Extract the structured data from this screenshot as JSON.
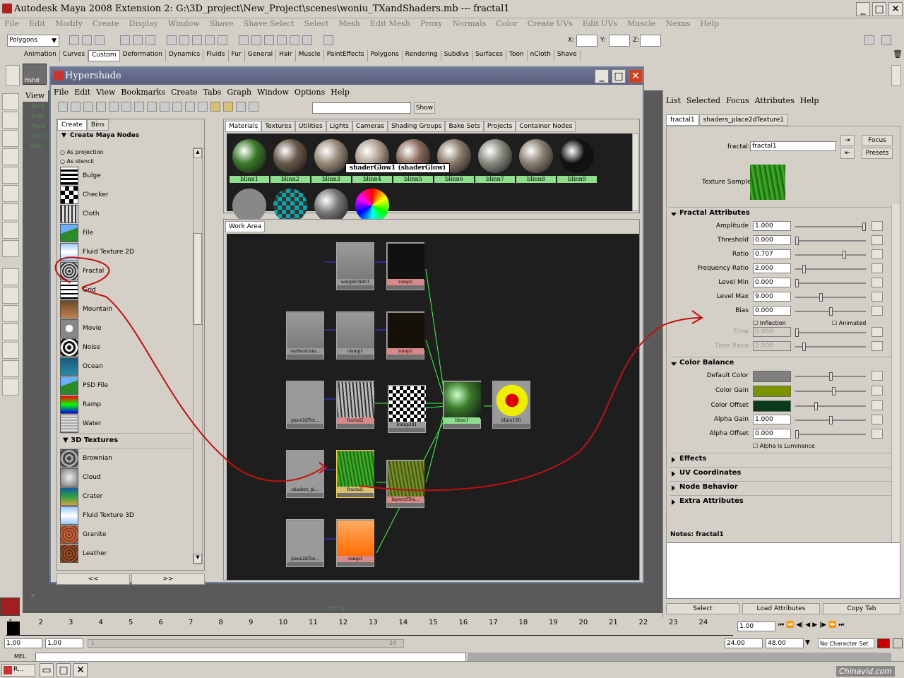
{
  "window": {
    "title": "Autodesk Maya 2008 Extension 2: G:\\3D_project\\New_Project\\scenes\\woniu_TXandShaders.mb   ---   fractal1"
  },
  "main_menu": [
    "File",
    "Edit",
    "Modify",
    "Create",
    "Display",
    "Window",
    "Shave",
    "Shave Select",
    "Select",
    "Mesh",
    "Edit Mesh",
    "Proxy",
    "Normals",
    "Color",
    "Create UVs",
    "Edit UVs",
    "Muscle",
    "Nexus",
    "Help"
  ],
  "status_line": {
    "mode_select": "Polygons",
    "x_label": "X:",
    "y_label": "Y:",
    "z_label": "Z:"
  },
  "shelf_tabs": [
    "Animation",
    "Curves",
    "Custom",
    "Deformation",
    "Dynamics",
    "Fluids",
    "Fur",
    "General",
    "Hair",
    "Muscle",
    "PaintEffects",
    "Polygons",
    "Rendering",
    "Subdivs",
    "Surfaces",
    "Toon",
    "nCloth",
    "Shave"
  ],
  "shelf_active": "Custom",
  "viewport": {
    "tab": "View",
    "hud": [
      "Vert",
      "Edge",
      "Face",
      "Tris",
      "UVs:"
    ],
    "camera": "persp",
    "shelf_label": "Hshd"
  },
  "hypershade": {
    "title": "Hypershade",
    "menu": [
      "File",
      "Edit",
      "View",
      "Bookmarks",
      "Create",
      "Tabs",
      "Graph",
      "Window",
      "Options",
      "Help"
    ],
    "show_button": "Show",
    "create_tabs": [
      "Create",
      "Bins"
    ],
    "create_header": "Create Maya Nodes",
    "projection_options": [
      "As projection",
      "As stencil"
    ],
    "tex2d": [
      "Bulge",
      "Checker",
      "Cloth",
      "File",
      "Fluid Texture 2D",
      "Fractal",
      "Grid",
      "Mountain",
      "Movie",
      "Noise",
      "Ocean",
      "PSD File",
      "Ramp",
      "Water"
    ],
    "tex3d_header": "3D Textures",
    "tex3d": [
      "Brownian",
      "Cloud",
      "Crater",
      "Fluid Texture 3D",
      "Granite",
      "Leather"
    ],
    "scroll_prev": "<<",
    "scroll_next": ">>",
    "material_tabs": [
      "Materials",
      "Textures",
      "Utilities",
      "Lights",
      "Cameras",
      "Shading Groups",
      "Bake Sets",
      "Projects",
      "Container Nodes"
    ],
    "materials": [
      "blinn1",
      "blinn2",
      "blinn3",
      "blinn4",
      "blinn5",
      "blinn6",
      "blinn7",
      "blinn8",
      "blinn9"
    ],
    "tooltip": "shaderGlow1 (shaderGlow)",
    "work_tab": "Work Area",
    "graph_nodes": [
      {
        "label": "samplerInfo1",
        "color": "#9a9a9a"
      },
      {
        "label": "ramp1",
        "color": "#d88a8a"
      },
      {
        "label": "surfaceLum...",
        "color": "#9a9a9a"
      },
      {
        "label": "clamp1",
        "color": "#9a9a9a"
      },
      {
        "label": "ramp2",
        "color": "#d88a8a"
      },
      {
        "label": "place2dTex...",
        "color": "#9a9a9a"
      },
      {
        "label": "fractal2",
        "color": "#d88a8a"
      },
      {
        "label": "bump2d1",
        "color": "#9a9a9a"
      },
      {
        "label": "blinn1",
        "color": "#8ede8e"
      },
      {
        "label": "blinn1SG",
        "color": "#9a9a9a"
      },
      {
        "label": "shaders_pl...",
        "color": "#9a9a9a"
      },
      {
        "label": "fractal1",
        "color": "#d8c070"
      },
      {
        "label": "layeredTex...",
        "color": "#d88a8a"
      },
      {
        "label": "place2dTex...",
        "color": "#9a9a9a"
      },
      {
        "label": "ramp3",
        "color": "#d88a8a"
      }
    ]
  },
  "attr_editor": {
    "menu": [
      "List",
      "Selected",
      "Focus",
      "Attributes",
      "Help"
    ],
    "tabs": [
      "fractal1",
      "shaders_place2dTexture1"
    ],
    "node_label": "fractal:",
    "node_name": "fractal1",
    "focus_button": "Focus",
    "presets_button": "Presets",
    "texture_sample_label": "Texture Sample",
    "fractal_section": "Fractal Attributes",
    "fractal_attrs": [
      {
        "label": "Amplitude",
        "value": "1.000",
        "level": 1.0
      },
      {
        "label": "Threshold",
        "value": "0.000",
        "level": 0.0
      },
      {
        "label": "Ratio",
        "value": "0.707",
        "level": 0.707
      },
      {
        "label": "Frequency Ratio",
        "value": "2.000",
        "level": 0.1
      },
      {
        "label": "Level Min",
        "value": "0.000",
        "level": 0.0
      },
      {
        "label": "Level Max",
        "value": "9.000",
        "level": 0.36
      },
      {
        "label": "Bias",
        "value": "0.000",
        "level": 0.5
      }
    ],
    "inflection_label": "Inflection",
    "animated_label": "Animated",
    "time_attrs": [
      {
        "label": "Time",
        "value": "0.000",
        "level": 0.0
      },
      {
        "label": "Time Ratio",
        "value": "2.000",
        "level": 0.1
      }
    ],
    "color_section": "Color Balance",
    "color_attrs": [
      {
        "label": "Default Color",
        "color": "#808080",
        "level": 0.5
      },
      {
        "label": "Color Gain",
        "color": "#7a9400",
        "level": 0.55
      },
      {
        "label": "Color Offset",
        "color": "#0a3a1a",
        "level": 0.28
      }
    ],
    "alpha_attrs": [
      {
        "label": "Alpha Gain",
        "value": "1.000",
        "level": 0.5
      },
      {
        "label": "Alpha Offset",
        "value": "0.000",
        "level": 0.0
      }
    ],
    "alpha_lum_label": "Alpha Is Luminance",
    "collapsed_sections": [
      "Effects",
      "UV Coordinates",
      "Node Behavior",
      "Extra Attributes"
    ],
    "notes_label": "Notes:  fractal1",
    "bottom_buttons": [
      "Select",
      "Load Attributes",
      "Copy Tab"
    ]
  },
  "timeline": {
    "ticks": [
      "1",
      "2",
      "3",
      "4",
      "5",
      "6",
      "7",
      "8",
      "9",
      "10",
      "11",
      "12",
      "13",
      "14",
      "15",
      "16",
      "17",
      "18",
      "19",
      "20",
      "21",
      "22",
      "23",
      "24"
    ],
    "current_frame": "1.00",
    "range_start": "1.00",
    "range_start2": "1.00",
    "range_mark_start": "1",
    "range_mark_end": "24",
    "range_end": "24.00",
    "range_end2": "48.00",
    "character_set": "No Character Set"
  },
  "command_line": {
    "label": "MEL"
  },
  "taskbar": {
    "item": "R...",
    "watermark": "Chinavid.com"
  }
}
